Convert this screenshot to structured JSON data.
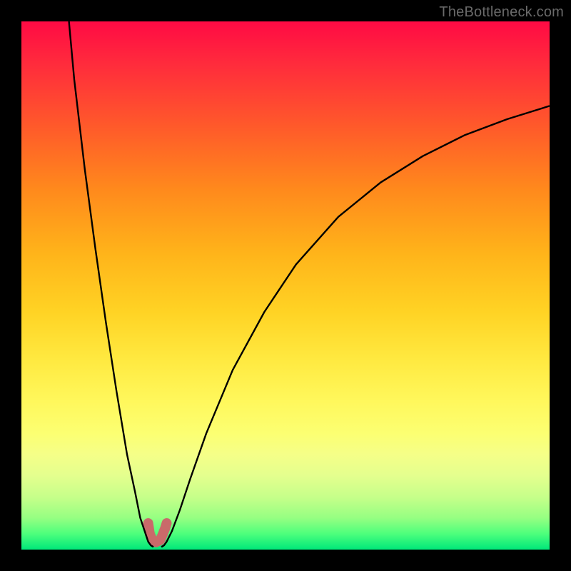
{
  "watermark": "TheBottleneck.com",
  "chart_data": {
    "type": "line",
    "title": "",
    "xlabel": "",
    "ylabel": "",
    "xlim": [
      0,
      100
    ],
    "ylim": [
      0,
      100
    ],
    "grid": false,
    "legend": false,
    "series": [
      {
        "name": "left-branch",
        "x": [
          9.0,
          10.0,
          12.0,
          14.0,
          16.0,
          18.0,
          20.0,
          21.5,
          22.5,
          23.5,
          24.0,
          24.5,
          25.0
        ],
        "values": [
          100.0,
          89.0,
          72.0,
          57.0,
          43.0,
          30.0,
          18.0,
          11.0,
          6.0,
          3.0,
          1.5,
          0.8,
          0.5
        ]
      },
      {
        "name": "right-branch",
        "x": [
          26.5,
          27.0,
          27.5,
          28.5,
          30.0,
          32.0,
          35.0,
          40.0,
          46.0,
          52.0,
          60.0,
          68.0,
          76.0,
          84.0,
          92.0,
          100.0
        ],
        "values": [
          0.5,
          0.8,
          1.5,
          3.5,
          7.5,
          13.5,
          22.0,
          34.0,
          45.0,
          54.0,
          63.0,
          69.5,
          74.5,
          78.5,
          81.5,
          84.0
        ]
      },
      {
        "name": "min-marker",
        "x": [
          24.0,
          24.3,
          24.8,
          25.5,
          26.3,
          26.8,
          27.2,
          27.5
        ],
        "values": [
          5.0,
          3.0,
          1.8,
          1.4,
          1.8,
          3.0,
          4.0,
          5.0
        ]
      }
    ],
    "annotations": {
      "min_x_approx": 25.7,
      "min_y_approx": 0.5
    }
  },
  "style": {
    "curve_color": "#000000",
    "curve_width": 2.4,
    "marker_color": "#c96a6a",
    "marker_width": 14,
    "marker_linecap": "round"
  }
}
